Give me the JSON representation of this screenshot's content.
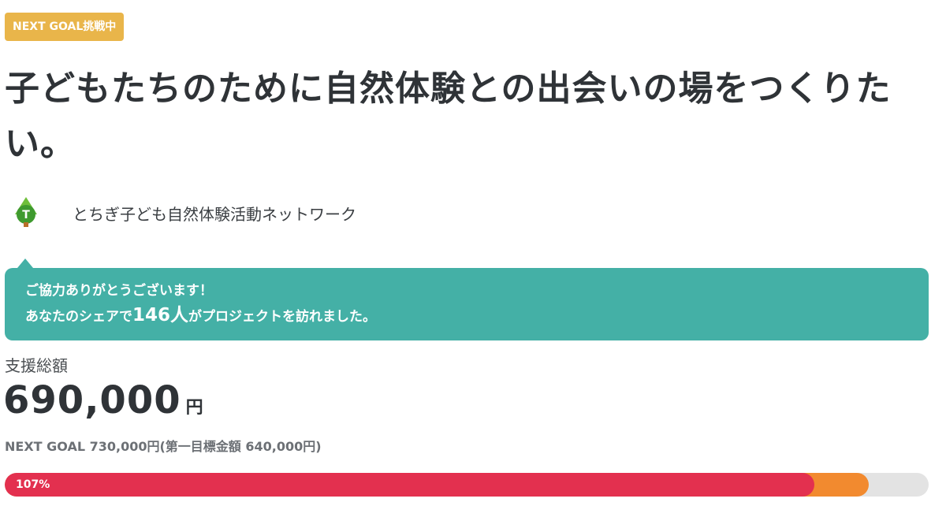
{
  "badge": {
    "label": "NEXT GOAL挑戦中"
  },
  "project": {
    "title": "子どもたちのために自然体験との出会いの場をつくりたい。",
    "owner_name": "とちぎ子ども自然体験活動ネットワーク",
    "owner_icon": "tree-icon",
    "owner_icon_letter": "T"
  },
  "share": {
    "line1": "ご協力ありがとうございます！",
    "line2_prefix": "あなたのシェアで",
    "count": "146人",
    "line2_suffix": "がプロジェクトを訪れました。"
  },
  "funding": {
    "total_label": "支援総額",
    "amount": "690,000",
    "unit": "円",
    "goal_text": "NEXT GOAL 730,000円(第一目標金額 640,000円)",
    "progress_label": "107%",
    "progress_main_fraction": 0.876,
    "progress_next_fraction": 0.935
  },
  "colors": {
    "badge": "#e9b54a",
    "share_box": "#44b0a6",
    "progress_main": "#e3304f",
    "progress_next": "#f28a2f",
    "progress_track": "#e3e3e3"
  }
}
